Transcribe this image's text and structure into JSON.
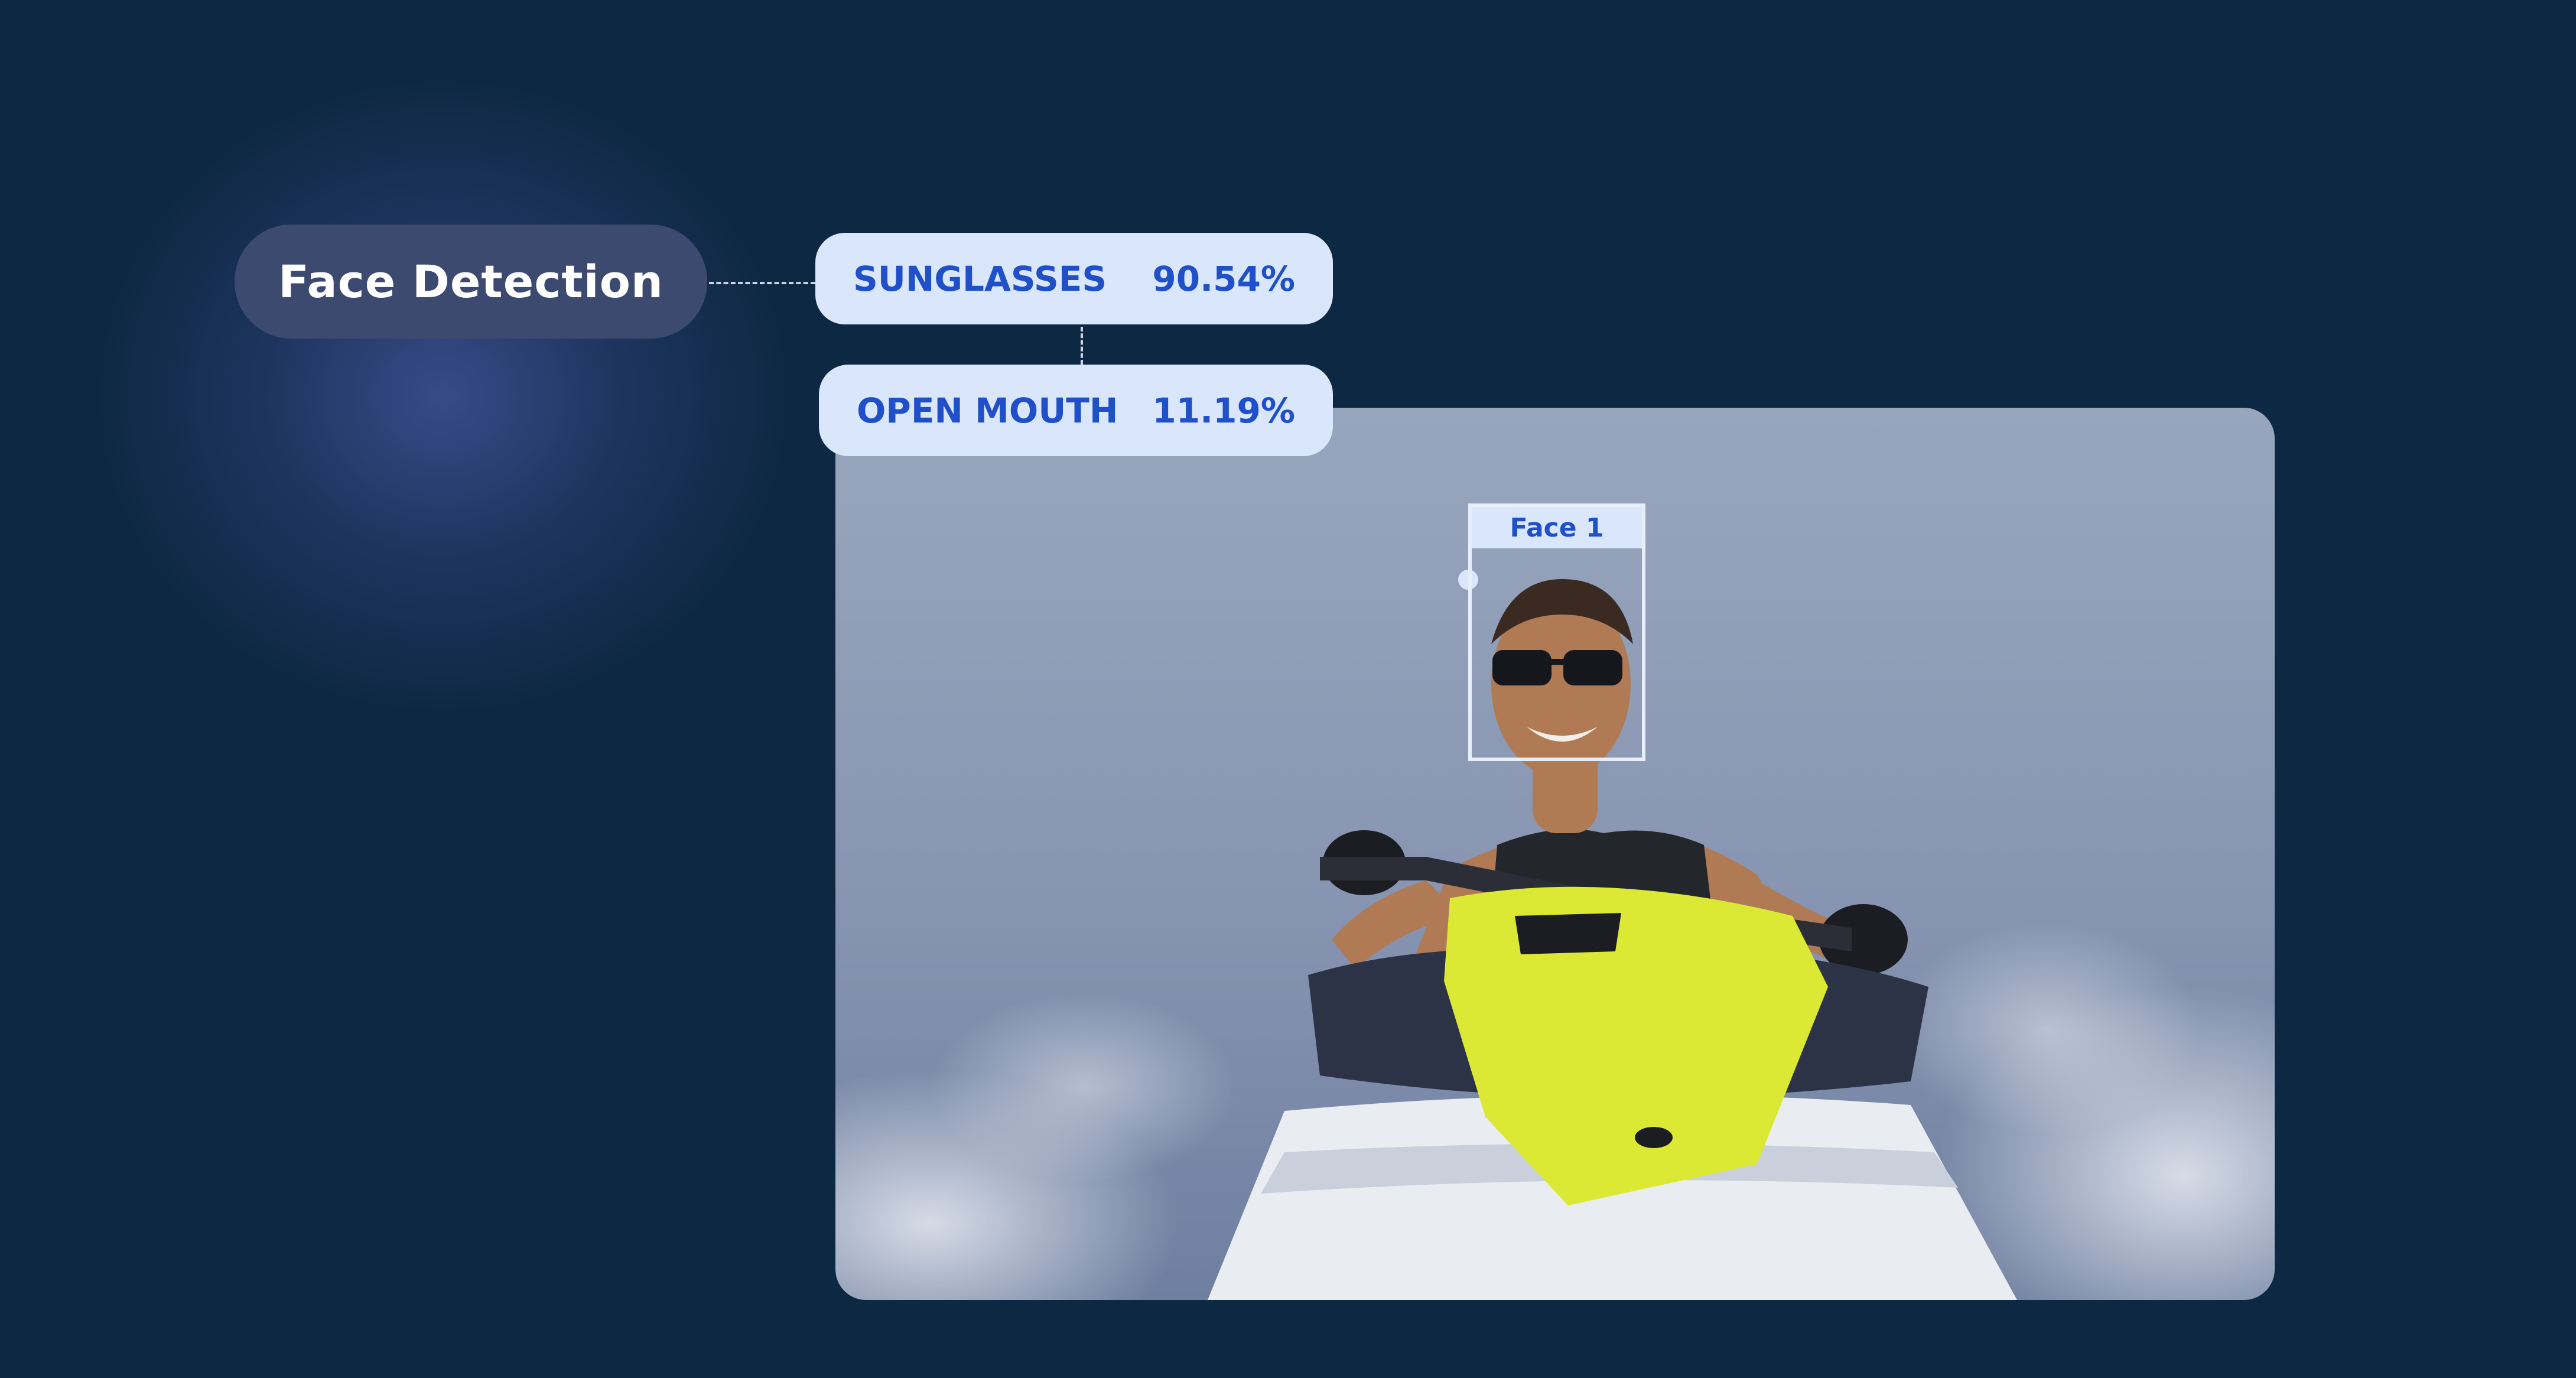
{
  "panel": {
    "title": "Face Detection"
  },
  "attributes": [
    {
      "label": "SUNGLASSES",
      "score": "90.54%"
    },
    {
      "label": "OPEN MOUTH",
      "score": "11.19%"
    }
  ],
  "detection": {
    "face_label": "Face 1"
  },
  "colors": {
    "background": "#0d2842",
    "pill": "#3d4a70",
    "tag_background": "#d9e6fb",
    "tag_text": "#1f4fc9",
    "connector": "#c9d4e6"
  }
}
